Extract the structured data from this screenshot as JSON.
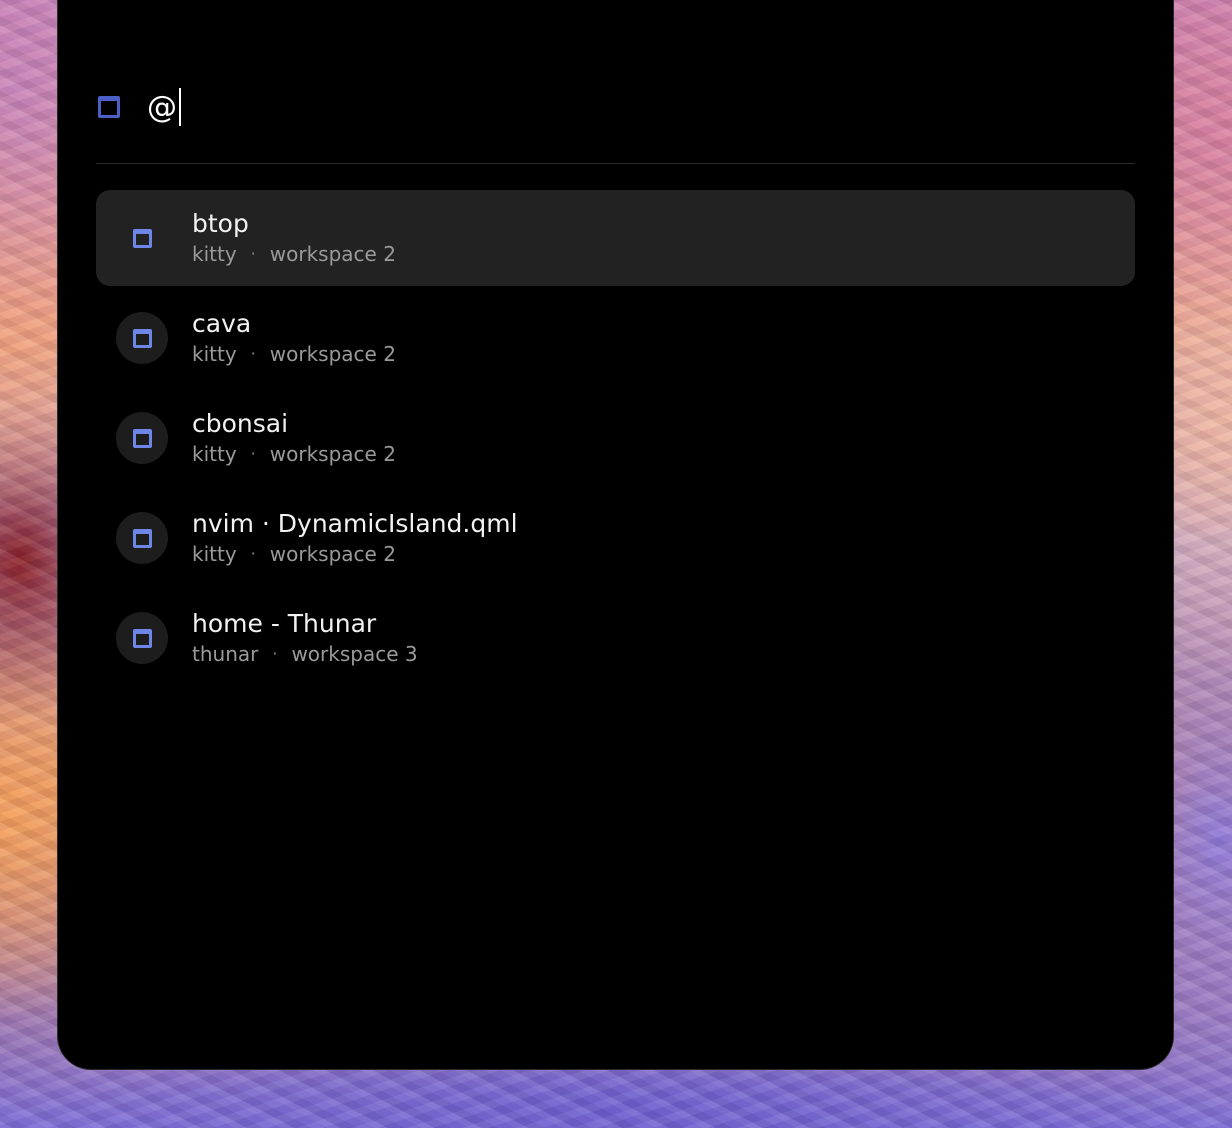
{
  "search": {
    "icon": "window-icon",
    "query": "@"
  },
  "results": [
    {
      "title": "btop",
      "app": "kitty",
      "separator": "·",
      "workspace": "workspace 2",
      "icon": "window-icon",
      "selected": true
    },
    {
      "title": "cava",
      "app": "kitty",
      "separator": "·",
      "workspace": "workspace 2",
      "icon": "window-icon",
      "selected": false
    },
    {
      "title": "cbonsai",
      "app": "kitty",
      "separator": "·",
      "workspace": "workspace 2",
      "icon": "window-icon",
      "selected": false
    },
    {
      "title": "nvim · DynamicIsland.qml",
      "app": "kitty",
      "separator": "·",
      "workspace": "workspace 2",
      "icon": "window-icon",
      "selected": false
    },
    {
      "title": "home - Thunar",
      "app": "thunar",
      "separator": "·",
      "workspace": "workspace 3",
      "icon": "window-icon",
      "selected": false
    }
  ],
  "colors": {
    "panel_background": "#000000",
    "selected_row": "#222222",
    "icon_accent": "#6d86e8"
  }
}
